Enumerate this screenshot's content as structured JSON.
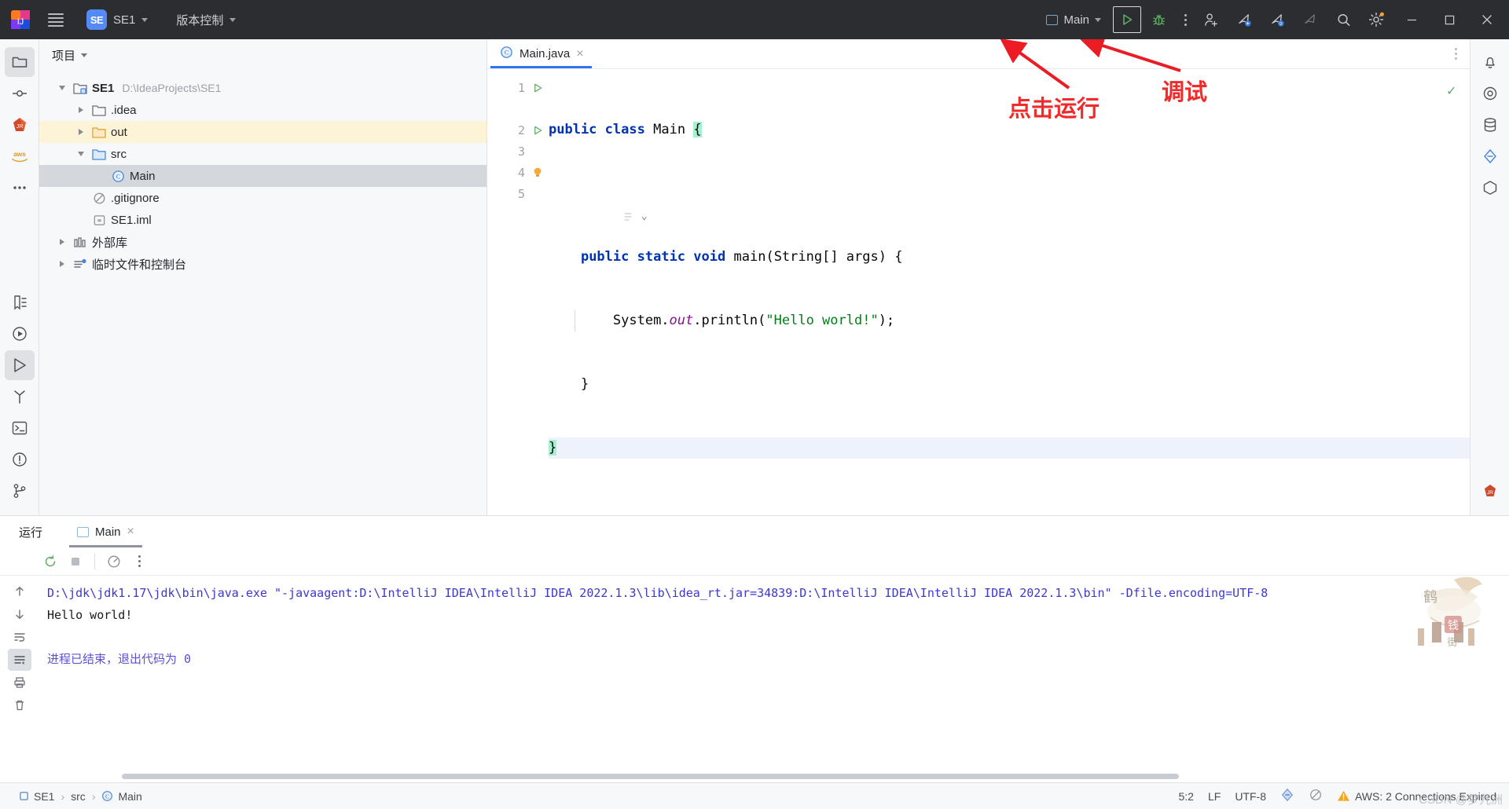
{
  "titlebar": {
    "menu_icon": "hamburger-icon",
    "project_badge": "SE",
    "project_name": "SE1",
    "vcs_label": "版本控制",
    "run_config_name": "Main",
    "run_tooltip": "运行",
    "debug_tooltip": "调试",
    "icons": [
      "add-user-icon",
      "feedback-icon",
      "feedback-zero-icon",
      "feedback-dim-icon",
      "search-icon",
      "settings-icon"
    ],
    "window_buttons": [
      "minimize",
      "maximize",
      "close"
    ]
  },
  "project_panel": {
    "header": "项目",
    "tree": [
      {
        "label": "SE1",
        "path": "D:\\IdeaProjects\\SE1",
        "icon": "module-folder-icon",
        "state": "expanded",
        "depth": 0,
        "bold": true
      },
      {
        "label": ".idea",
        "path": "",
        "icon": "folder-icon",
        "state": "collapsed",
        "depth": 1,
        "bold": false
      },
      {
        "label": "out",
        "path": "",
        "icon": "folder-orange-icon",
        "state": "collapsed",
        "depth": 1,
        "bold": false,
        "highlight": "marked"
      },
      {
        "label": "src",
        "path": "",
        "icon": "folder-blue-icon",
        "state": "expanded",
        "depth": 1,
        "bold": false
      },
      {
        "label": "Main",
        "path": "",
        "icon": "java-class-icon",
        "state": "leaf",
        "depth": 2,
        "bold": false,
        "highlight": "selected"
      },
      {
        "label": ".gitignore",
        "path": "",
        "icon": "gitignore-icon",
        "state": "leaf",
        "depth": 1,
        "bold": false
      },
      {
        "label": "SE1.iml",
        "path": "",
        "icon": "iml-icon",
        "state": "leaf",
        "depth": 1,
        "bold": false
      },
      {
        "label": "外部库",
        "path": "",
        "icon": "library-icon",
        "state": "collapsed",
        "depth": 0,
        "bold": false
      },
      {
        "label": "临时文件和控制台",
        "path": "",
        "icon": "scratches-icon",
        "state": "collapsed",
        "depth": 0,
        "bold": false
      }
    ]
  },
  "editor": {
    "tab_label": "Main.java",
    "tab_icon": "java-class-icon",
    "tab_close": "×",
    "inspection_status": "✓",
    "lines": [
      "1",
      "2",
      "3",
      "4",
      "5"
    ],
    "code": {
      "l1_kw1": "public",
      "l1_kw2": "class",
      "l1_name": "Main",
      "l1_brace": "{",
      "l2_kw1": "public",
      "l2_kw2": "static",
      "l2_kw3": "void",
      "l2_name": "main",
      "l2_params": "(String[] args) {",
      "l3_obj": "System.",
      "l3_field": "out",
      "l3_call": ".println(",
      "l3_str": "\"Hello world!\"",
      "l3_end": ");",
      "l4": "}",
      "l5": "}"
    }
  },
  "annotations": [
    {
      "text": "点击运行",
      "kind": "callout-run"
    },
    {
      "text": "调试",
      "kind": "callout-debug"
    }
  ],
  "run_panel": {
    "title": "运行",
    "tab_label": "Main",
    "tab_close": "×",
    "toolbar": [
      "rerun-icon",
      "stop-icon",
      "coverage-icon",
      "more-icon"
    ],
    "side_toolbar": [
      "up-icon",
      "down-icon",
      "wrap-icon",
      "soft-wrap-icon",
      "print-icon",
      "trash-icon"
    ],
    "console": {
      "command": "D:\\jdk\\jdk1.17\\jdk\\bin\\java.exe \"-javaagent:D:\\IntelliJ IDEA\\IntelliJ IDEA 2022.1.3\\lib\\idea_rt.jar=34839:D:\\IntelliJ IDEA\\IntelliJ IDEA 2022.1.3\\bin\" -Dfile.encoding=UTF-8",
      "output": "Hello world!",
      "exit": "进程已结束，退出代码为  0"
    }
  },
  "statusbar": {
    "breadcrumbs": [
      "SE1",
      "src",
      "Main"
    ],
    "caret_position": "5:2",
    "line_separator": "LF",
    "encoding": "UTF-8",
    "indent_icon": "indent-icon",
    "inspection_icon": "inspection-off-icon",
    "warning_text": "AWS: 2 Connections Expired",
    "watermark": "CSDN @梦九洲"
  },
  "colors": {
    "titlebar_bg": "#2b2d30",
    "panel_bg": "#f7f8fa",
    "accent_blue": "#3574f0",
    "run_green": "#59a869",
    "annotation_red": "#ec1c24",
    "selection_gray": "#d4d7dc",
    "marked_yellow": "#fdf3d7",
    "keyword_blue": "#0033b3",
    "string_green": "#067d17",
    "field_purple": "#871094",
    "console_blue": "#3a37d1"
  }
}
